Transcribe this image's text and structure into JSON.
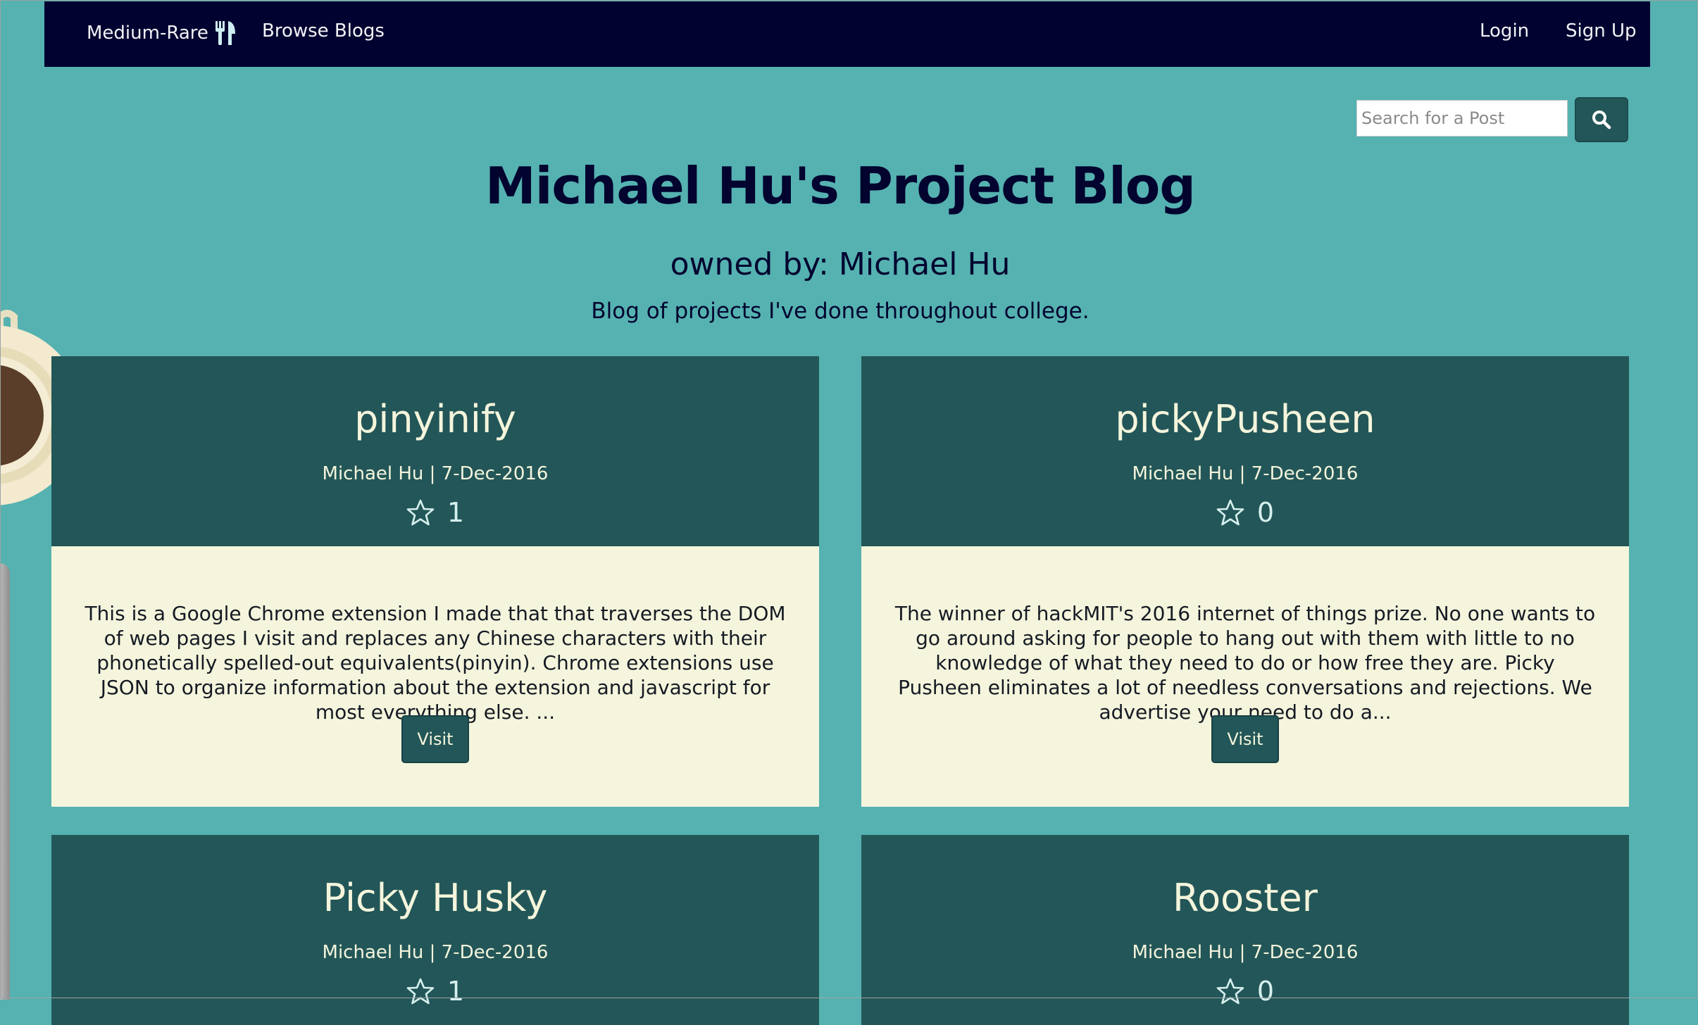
{
  "navbar": {
    "brand": "Medium-Rare",
    "brand_icon": "fork-knife-icon",
    "browse": "Browse Blogs",
    "login": "Login",
    "signup": "Sign Up"
  },
  "search": {
    "placeholder": "Search for a Post",
    "icon": "search-icon"
  },
  "blog": {
    "title": "Michael Hu's Project Blog",
    "owner": "owned by: Michael Hu",
    "description": "Blog of projects I've done throughout college."
  },
  "posts": [
    {
      "title": "pinyinify",
      "meta": "Michael Hu | 7-Dec-2016",
      "stars": "1",
      "excerpt": "This is a Google Chrome extension I made that that traverses the DOM of web pages I visit and replaces any Chinese characters with their phonetically spelled-out equivalents(pinyin). Chrome extensions use JSON to organize information about the extension and javascript for most everything else. ...",
      "button": "Visit"
    },
    {
      "title": "pickyPusheen",
      "meta": "Michael Hu | 7-Dec-2016",
      "stars": "0",
      "excerpt": "The winner of hackMIT's 2016 internet of things prize. No one wants to go around asking for people to hang out with them with little to no knowledge of what they need to do or how free they are. Picky Pusheen eliminates a lot of needless conversations and rejections. We advertise your need to do a...",
      "button": "Visit"
    },
    {
      "title": "Picky Husky",
      "meta": "Michael Hu | 7-Dec-2016",
      "stars": "1"
    },
    {
      "title": "Rooster",
      "meta": "Michael Hu | 7-Dec-2016",
      "stars": "0"
    }
  ],
  "colors": {
    "background": "#55b2b0",
    "navbar": "#020230",
    "card_header": "#235658",
    "card_body": "#f4f5dc",
    "title_text": "#02032f"
  }
}
